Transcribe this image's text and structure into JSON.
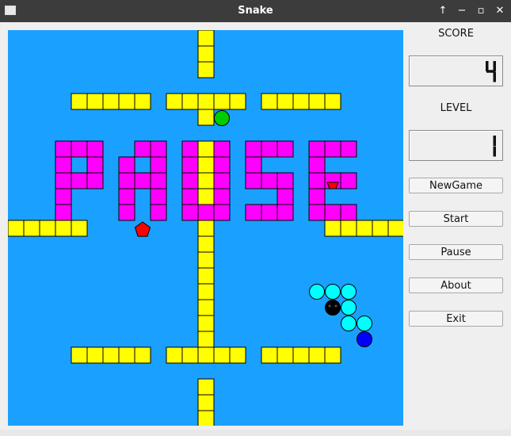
{
  "window": {
    "title": "Snake"
  },
  "side": {
    "score_label": "SCORE",
    "score_value": "4",
    "level_label": "LEVEL",
    "level_value": "1"
  },
  "buttons": {
    "new_game": "NewGame",
    "start": "Start",
    "pause": "Pause",
    "about": "About",
    "exit": "Exit"
  },
  "game": {
    "state": "PAUSE",
    "colors": {
      "background": "#1aa0ff",
      "wall": "#ffff00",
      "pause_text": "#ff00ff",
      "snake_body": "#00ffff",
      "snake_head": "#000000",
      "snake_tail": "#0000ff",
      "green_food": "#00cc00",
      "red_bonus": "#ff0000"
    }
  }
}
